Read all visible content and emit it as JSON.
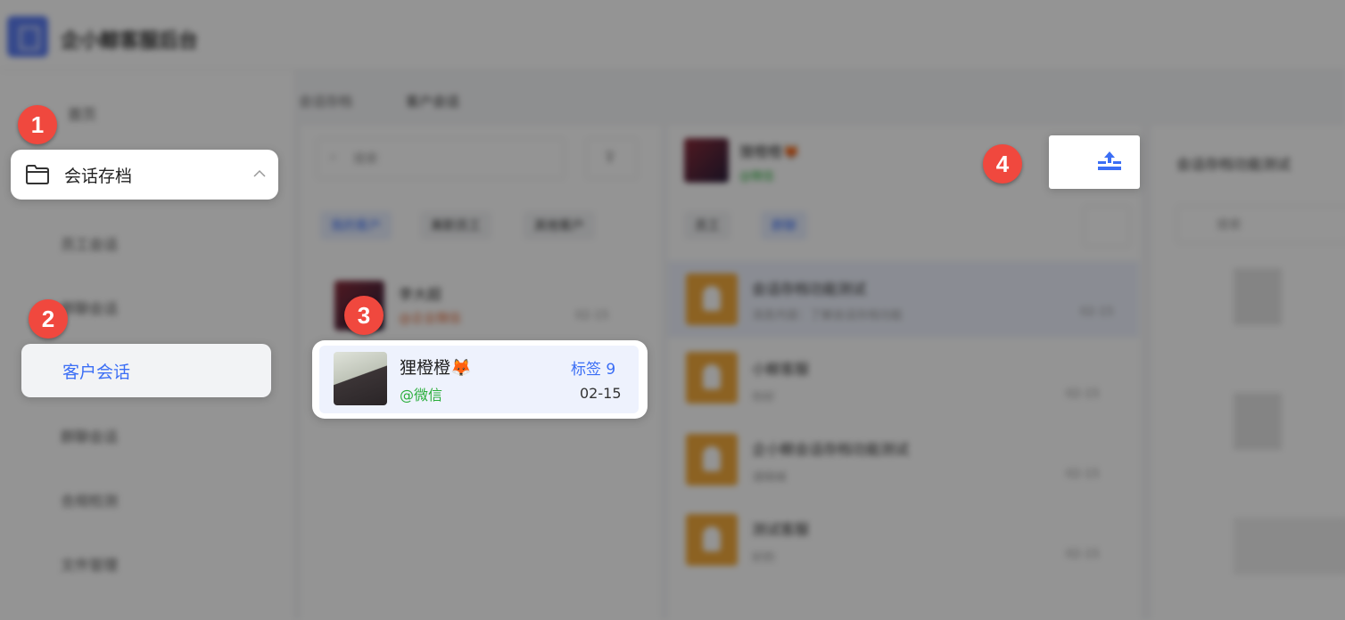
{
  "app": {
    "title": "企小鲸客服后台"
  },
  "breadcrumb": {
    "parent": "会话存档",
    "current": "客户会话"
  },
  "sidebar": {
    "items": [
      {
        "label": "首页"
      },
      {
        "label": "会话存档"
      },
      {
        "label": "员工会话"
      },
      {
        "label": "群聊会话"
      },
      {
        "label": "客户会话"
      },
      {
        "label": "群聊会话"
      },
      {
        "label": "合规检测"
      },
      {
        "label": "文件管理"
      }
    ]
  },
  "customer_list": {
    "search_placeholder": "搜索",
    "tabs": [
      {
        "label": "我的客户"
      },
      {
        "label": "离职员工"
      },
      {
        "label": "其他客户"
      }
    ],
    "items": [
      {
        "name": "李大超",
        "source": "@企业微信",
        "time": "02-15"
      },
      {
        "name": "狸橙橙🦊",
        "tag": "标签 9",
        "source": "@微信",
        "time": "02-15"
      }
    ]
  },
  "chat_header": {
    "name": "狸橙橙🦊",
    "source": "@微信",
    "tabs": [
      {
        "label": "员工"
      },
      {
        "label": "群聊"
      }
    ]
  },
  "conversation_list": [
    {
      "name": "会话存档功能测试",
      "preview": "消息内容：了解会话存档功能",
      "time": "02-15"
    },
    {
      "name": "小鲸客服",
      "preview": "你好",
      "time": "02-15"
    },
    {
      "name": "企小鲸会话存档功能测试",
      "preview": "请稍候",
      "time": "02-15"
    },
    {
      "name": "测试客服",
      "preview": "好的",
      "time": "02-15"
    }
  ],
  "right_panel": {
    "title": "会话存档功能测试",
    "search_placeholder": "搜索"
  },
  "highlight": {
    "folder_menu_label": "会话存档",
    "active_nav_label": "客户会话",
    "card": {
      "name": "狸橙橙🦊",
      "tag": "标签 9",
      "source": "@微信",
      "time": "02-15"
    }
  },
  "steps": [
    "1",
    "2",
    "3",
    "4"
  ],
  "colors": {
    "accent_blue": "#3b6ef5",
    "wechat_green": "#2aae3b",
    "badge_red": "#f0483e",
    "avatar_orange": "#f2a93b"
  },
  "icons": {
    "folder": "folder-icon",
    "collapse": "chevron-up-icon",
    "export": "export-upload-icon",
    "search": "search-icon",
    "filter": "filter-icon"
  }
}
